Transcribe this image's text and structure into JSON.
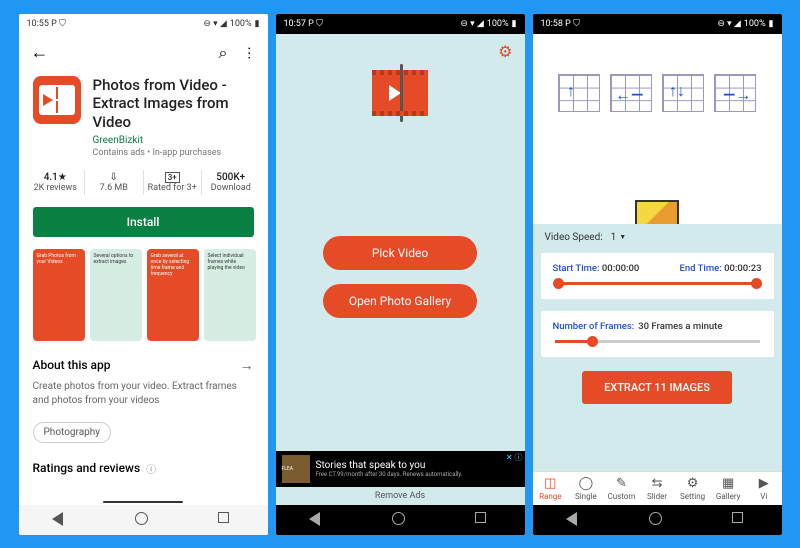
{
  "status": {
    "t1": "10:55",
    "t2": "10:57",
    "t3": "10:58",
    "icons_left": "P ⛉",
    "icons_right": "⊖ ▾ ◢",
    "battery": "100%",
    "batt_icon": "▮"
  },
  "screen1": {
    "title": "Photos from Video - Extract Images from Video",
    "developer": "GreenBizkit",
    "subtitle": "Contains ads  •  In-app purchases",
    "stats": [
      {
        "top": "4.1★",
        "bottom": "2K reviews"
      },
      {
        "top": "⇩",
        "bottom": "7.6 MB"
      },
      {
        "top": "3+",
        "bottom": "Rated for 3+"
      },
      {
        "top": "500K+",
        "bottom": "Download"
      }
    ],
    "install": "Install",
    "shots": [
      {
        "text": "Grab Photos from your Videos"
      },
      {
        "text": "Several options to extract images"
      },
      {
        "text": "Grab several at once by selecting time frame and frequency"
      },
      {
        "text": "Select individual frames while playing the video"
      }
    ],
    "about_label": "About this app",
    "about_desc": "Create photos from your video. Extract frames and photos from your videos",
    "tag": "Photography",
    "reviews_label": "Ratings and reviews",
    "info_icon": "ⓘ"
  },
  "screen2": {
    "btn1": "Pick Video",
    "btn2": "Open Photo Gallery",
    "ad_title": "Stories that speak to you",
    "ad_sub": "Free CT.99/month after 30 days. Renews automatically.",
    "ad_brand": "FLEA",
    "ad_x": "✕ ⓘ",
    "remove": "Remove Ads"
  },
  "screen3": {
    "speed_label": "Video Speed:",
    "speed_value": "1",
    "start_label": "Start Time:",
    "start_value": "00:00:00",
    "end_label": "End Time:",
    "end_value": "00:00:23",
    "frames_label": "Number of Frames:",
    "frames_value": "30 Frames a minute",
    "extract": "EXTRACT 11 IMAGES",
    "tabs": [
      {
        "icon": "◫",
        "label": "Range"
      },
      {
        "icon": "◯",
        "label": "Single"
      },
      {
        "icon": "✎",
        "label": "Custom"
      },
      {
        "icon": "⇆",
        "label": "Slider"
      },
      {
        "icon": "⚙",
        "label": "Setting"
      },
      {
        "icon": "▦",
        "label": "Gallery"
      },
      {
        "icon": "▶",
        "label": "Vi"
      }
    ]
  }
}
